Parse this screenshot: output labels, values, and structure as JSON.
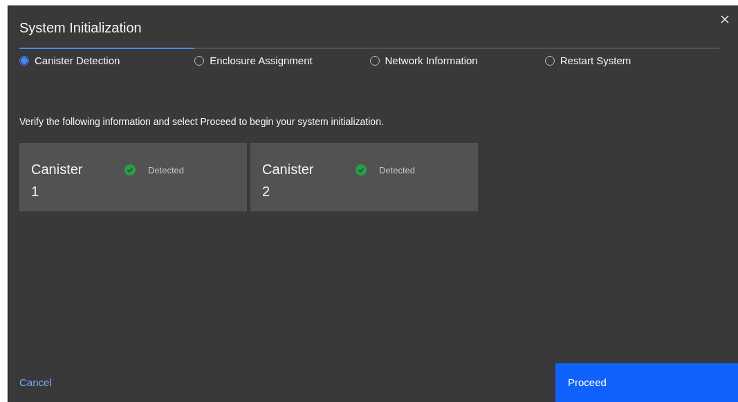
{
  "dialog": {
    "title": "System Initialization"
  },
  "steps": [
    {
      "label": "Canister Detection",
      "selected": true
    },
    {
      "label": "Enclosure Assignment",
      "selected": false
    },
    {
      "label": "Network Information",
      "selected": false
    },
    {
      "label": "Restart System",
      "selected": false
    }
  ],
  "instruction": "Verify the following information and select Proceed to begin your system initialization.",
  "canisters": [
    {
      "name": "Canister",
      "number": "1",
      "status": "Detected",
      "kind": "ok"
    },
    {
      "name": "Canister",
      "number": "2",
      "status": "Detected",
      "kind": "ok"
    }
  ],
  "footer": {
    "cancel": "Cancel",
    "proceed": "Proceed"
  }
}
